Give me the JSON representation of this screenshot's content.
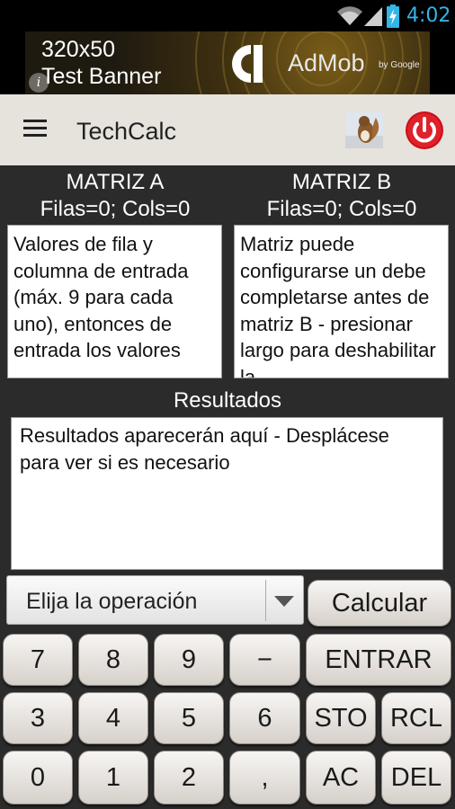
{
  "status_bar": {
    "time": "4:02",
    "icons": [
      "wifi-icon",
      "signal-icon",
      "battery-charging-icon"
    ]
  },
  "ad": {
    "line1": "320x50",
    "line2": "Test Banner",
    "brand": "AdMob",
    "by": "by Google",
    "info": "i"
  },
  "app_bar": {
    "title": "TechCalc",
    "icons": [
      "menu-icon",
      "squirrel-image-icon",
      "power-icon"
    ]
  },
  "matrix_a": {
    "title": "MATRIZ A",
    "dims": "Filas=0; Cols=0",
    "text": "Valores de fila y columna de entrada (máx. 9 para cada uno), entonces de entrada los valores"
  },
  "matrix_b": {
    "title": "MATRIZ B",
    "dims": "Filas=0; Cols=0",
    "text": "Matriz puede configurarse un debe completarse antes de matriz B - presionar largo para deshabilitar la"
  },
  "results": {
    "title": "Resultados",
    "text": "Resultados aparecerán aquí - Desplácese para ver si es necesario"
  },
  "operation": {
    "selected": "Elija la operación"
  },
  "buttons": {
    "calc": "Calcular",
    "k7": "7",
    "k8": "8",
    "k9": "9",
    "minus": "−",
    "enter": "ENTRAR",
    "k3": "3",
    "k4": "4",
    "k5": "5",
    "k6": "6",
    "sto": "STO",
    "rcl": "RCL",
    "k0": "0",
    "k1": "1",
    "k2": "2",
    "comma": ",",
    "ac": "AC",
    "del": "DEL"
  },
  "colors": {
    "time": "#33b5e5",
    "appbar": "#e6e2dc",
    "background": "#2b2b2b",
    "power": "#d9121b"
  }
}
